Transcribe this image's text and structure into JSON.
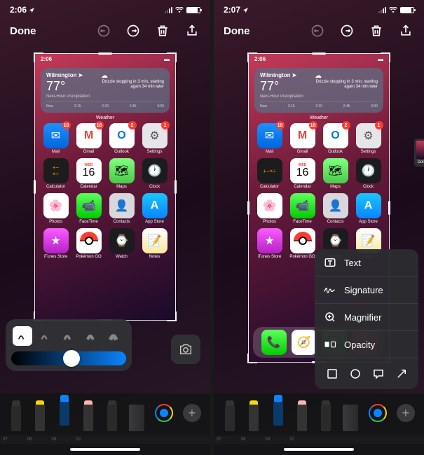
{
  "left": {
    "status_time": "2:06",
    "toolbar": {
      "done": "Done"
    },
    "screenshot": {
      "status_time": "2:06",
      "weather": {
        "location": "Wilmington",
        "temp": "77°",
        "desc": "Drizzle stopping in 3 min, starting again 34 min later",
        "sub": "Next-Hour Precipitation",
        "timeline": [
          "Now",
          "2:15",
          "2:30",
          "2:45",
          "3:00"
        ],
        "label": "Weather"
      },
      "apps_row1": [
        {
          "label": "Mail",
          "badge": "18"
        },
        {
          "label": "Gmail",
          "badge": "18"
        },
        {
          "label": "Outlook",
          "badge": "2"
        },
        {
          "label": "Settings",
          "badge": "1"
        }
      ],
      "apps_row2": [
        {
          "label": "Calculator"
        },
        {
          "label": "Calendar",
          "day": "WED",
          "date": "16"
        },
        {
          "label": "Maps"
        },
        {
          "label": "Clock"
        }
      ],
      "apps_row3": [
        {
          "label": "Photos"
        },
        {
          "label": "FaceTime"
        },
        {
          "label": "Contacts"
        },
        {
          "label": "App Store"
        }
      ],
      "apps_row4": [
        {
          "label": "iTunes Store"
        },
        {
          "label": "Pokémon GO"
        },
        {
          "label": "Watch"
        },
        {
          "label": "Notes"
        }
      ]
    },
    "brush_slider_value": 0.45
  },
  "right": {
    "status_time": "2:07",
    "toolbar": {
      "done": "Done"
    },
    "thumb_label": "Don",
    "screenshot": {
      "status_time": "2:06",
      "weather": {
        "location": "Wilmington",
        "temp": "77°",
        "desc": "Drizzle stopping in 3 min, starting again 34 min later",
        "sub": "Next-Hour Precipitation",
        "timeline": [
          "Now",
          "2:15",
          "2:30",
          "2:45",
          "3:00"
        ],
        "label": "Weather"
      },
      "apps_row1": [
        {
          "label": "Mail",
          "badge": "18"
        },
        {
          "label": "Gmail",
          "badge": "18"
        },
        {
          "label": "Outlook",
          "badge": "2"
        },
        {
          "label": "Settings",
          "badge": "1"
        }
      ],
      "apps_row2": [
        {
          "label": "Calculator"
        },
        {
          "label": "Calendar",
          "day": "WED",
          "date": "16"
        },
        {
          "label": "Maps"
        },
        {
          "label": "Clock"
        }
      ],
      "apps_row3": [
        {
          "label": "Photos"
        },
        {
          "label": "FaceTime"
        },
        {
          "label": "Contacts"
        },
        {
          "label": "App Store"
        }
      ],
      "apps_row4": [
        {
          "label": "iTunes Store"
        },
        {
          "label": "Pokémon GO"
        },
        {
          "label": "Watch"
        },
        {
          "label": "Notes"
        }
      ]
    },
    "menu": {
      "text": "Text",
      "signature": "Signature",
      "magnifier": "Magnifier",
      "opacity": "Opacity"
    }
  },
  "ruler_ticks": [
    "07",
    "08",
    "09",
    "10"
  ]
}
